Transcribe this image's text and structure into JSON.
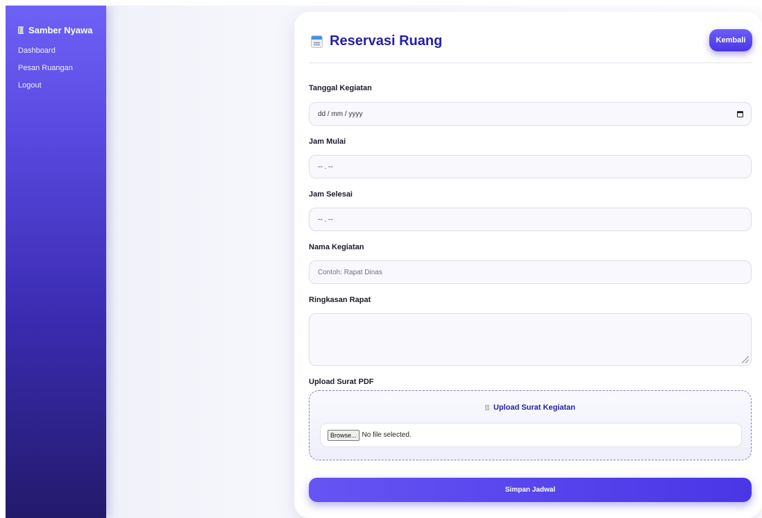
{
  "sidebar": {
    "brand": "Samber Nyawa",
    "brand_icon": "building-icon",
    "items": [
      {
        "label": "Dashboard"
      },
      {
        "label": "Pesan Ruangan"
      },
      {
        "label": "Logout"
      }
    ]
  },
  "header": {
    "title": "Reservasi Ruang",
    "title_icon": "calendar-icon",
    "back_label": "Kembali"
  },
  "form": {
    "tanggal": {
      "label": "Tanggal Kegiatan",
      "value": "dd / mm / yyyy"
    },
    "jam_mulai": {
      "label": "Jam Mulai",
      "value": "-- . --"
    },
    "jam_selesai": {
      "label": "Jam Selesai",
      "value": "-- . --"
    },
    "nama": {
      "label": "Nama Kegiatan",
      "placeholder": "Contoh: Rapat Dinas"
    },
    "ringkasan": {
      "label": "Ringkasan Rapat",
      "value": ""
    },
    "upload": {
      "label": "Upload Surat PDF",
      "zone_title": "Upload Surat Kegiatan",
      "browse_label": "Browse...",
      "file_status": "No file selected."
    },
    "submit_label": "Simpan Jadwal"
  },
  "colors": {
    "accent": "#4a36e6",
    "title": "#2520a8",
    "sidebar_top": "#6e61f6",
    "sidebar_bottom": "#231a6b"
  }
}
